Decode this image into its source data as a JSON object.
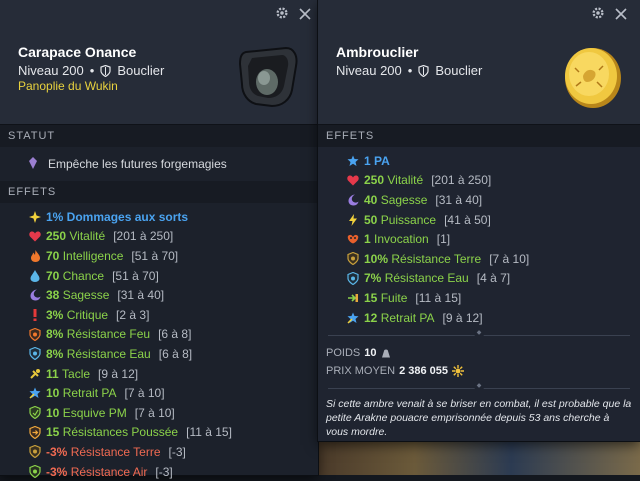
{
  "left_panel": {
    "name": "Carapace Onance",
    "level": "Niveau 200",
    "type": "Bouclier",
    "set": "Panoplie du Wukin",
    "statut_title": "STATUT",
    "statut_text": "Empêche les futures forgemagies",
    "effets_title": "EFFETS",
    "effects": [
      {
        "icon": "sparkle-icon",
        "value": "1% Dommages aux sorts",
        "range": "",
        "kind": "blue"
      },
      {
        "icon": "heart-icon",
        "value": "250",
        "label": "Vitalité",
        "range": "[201 à 250]",
        "kind": "pos"
      },
      {
        "icon": "fire-icon",
        "value": "70",
        "label": "Intelligence",
        "range": "[51 à 70]",
        "kind": "pos"
      },
      {
        "icon": "water-drop-icon",
        "value": "70",
        "label": "Chance",
        "range": "[51 à 70]",
        "kind": "pos"
      },
      {
        "icon": "moon-icon",
        "value": "38",
        "label": "Sagesse",
        "range": "[31 à 40]",
        "kind": "pos"
      },
      {
        "icon": "exclamation-icon",
        "value": "3%",
        "label": "Critique",
        "range": "[2 à 3]",
        "kind": "pos"
      },
      {
        "icon": "fire-shield-icon",
        "value": "8%",
        "label": "Résistance Feu",
        "range": "[6 à 8]",
        "kind": "pos"
      },
      {
        "icon": "water-shield-icon",
        "value": "8%",
        "label": "Résistance Eau",
        "range": "[6 à 8]",
        "kind": "pos"
      },
      {
        "icon": "tackle-icon",
        "value": "11",
        "label": "Tacle",
        "range": "[9 à 12]",
        "kind": "pos"
      },
      {
        "icon": "ap-retreat-icon",
        "value": "10",
        "label": "Retrait PA",
        "range": "[7 à 10]",
        "kind": "pos"
      },
      {
        "icon": "mp-dodge-icon",
        "value": "10",
        "label": "Esquive PM",
        "range": "[7 à 10]",
        "kind": "pos"
      },
      {
        "icon": "push-shield-icon",
        "value": "15",
        "label": "Résistances Poussée",
        "range": "[11 à 15]",
        "kind": "pos"
      },
      {
        "icon": "earth-shield-icon",
        "value": "-3%",
        "label": "Résistance Terre",
        "range": "[-3]",
        "kind": "neg"
      },
      {
        "icon": "air-shield-icon",
        "value": "-3%",
        "label": "Résistance Air",
        "range": "[-3]",
        "kind": "neg"
      }
    ]
  },
  "right_panel": {
    "name": "Ambrouclier",
    "level": "Niveau 200",
    "type": "Bouclier",
    "effets_title": "EFFETS",
    "effects": [
      {
        "icon": "star-icon",
        "value": "1 PA",
        "range": "",
        "kind": "blue"
      },
      {
        "icon": "heart-icon",
        "value": "250",
        "label": "Vitalité",
        "range": "[201 à 250]",
        "kind": "pos"
      },
      {
        "icon": "moon-icon",
        "value": "40",
        "label": "Sagesse",
        "range": "[31 à 40]",
        "kind": "pos"
      },
      {
        "icon": "lightning-icon",
        "value": "50",
        "label": "Puissance",
        "range": "[41 à 50]",
        "kind": "pos"
      },
      {
        "icon": "invocation-icon",
        "value": "1",
        "label": "Invocation",
        "range": "[1]",
        "kind": "pos"
      },
      {
        "icon": "earth-shield-icon",
        "value": "10%",
        "label": "Résistance Terre",
        "range": "[7 à 10]",
        "kind": "pos"
      },
      {
        "icon": "water-shield-icon",
        "value": "7%",
        "label": "Résistance Eau",
        "range": "[4 à 7]",
        "kind": "pos"
      },
      {
        "icon": "flee-icon",
        "value": "15",
        "label": "Fuite",
        "range": "[11 à 15]",
        "kind": "pos"
      },
      {
        "icon": "pa-retreat-icon",
        "value": "12",
        "label": "Retrait PA",
        "range": "[9 à 12]",
        "kind": "pos"
      }
    ],
    "poids_label": "POIDS",
    "poids_value": "10",
    "prix_label": "PRIX MOYEN",
    "prix_value": "2 386 055",
    "description": "Si cette ambre venait à se briser en combat, il est probable que la petite Arakne pouacre emprisonnée depuis 53 ans cherche à vous mordre."
  },
  "colors": {
    "positive": "#8bd24a",
    "blue": "#4aa3f0",
    "negative": "#f06a52",
    "set": "#e8d23e"
  }
}
